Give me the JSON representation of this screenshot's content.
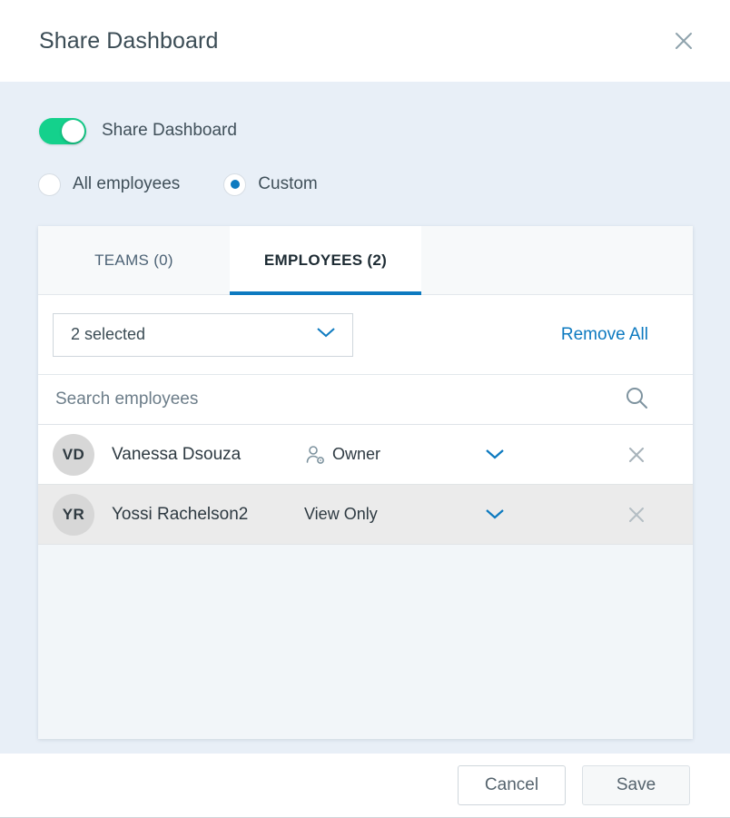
{
  "header": {
    "title": "Share Dashboard",
    "close_icon": "close-icon"
  },
  "share": {
    "toggle_label": "Share Dashboard",
    "toggle_on": true,
    "audience_options": [
      {
        "label": "All employees",
        "selected": false
      },
      {
        "label": "Custom",
        "selected": true
      }
    ]
  },
  "card": {
    "tabs": [
      {
        "label": "TEAMS (0)",
        "active": false
      },
      {
        "label": "EMPLOYEES (2)",
        "active": true
      }
    ],
    "selector": {
      "value": "2 selected",
      "chevron_icon": "chevron-down-icon"
    },
    "remove_all_label": "Remove All",
    "search": {
      "placeholder": "Search employees",
      "value": "",
      "icon": "search-icon"
    },
    "people": [
      {
        "initials": "VD",
        "name": "Vanessa Dsouza",
        "role": "Owner",
        "role_icon": "user-gear-icon",
        "chevron_icon": "chevron-down-icon",
        "remove_icon": "close-icon"
      },
      {
        "initials": "YR",
        "name": "Yossi Rachelson2",
        "role": "View Only",
        "role_icon": "",
        "chevron_icon": "chevron-down-icon",
        "remove_icon": "close-icon"
      }
    ]
  },
  "footer": {
    "cancel_label": "Cancel",
    "save_label": "Save"
  },
  "colors": {
    "accent_blue": "#0d7ac0",
    "toggle_green": "#14d18c",
    "body_background": "#e8eff7",
    "avatar_gray": "#d7d7d7"
  }
}
